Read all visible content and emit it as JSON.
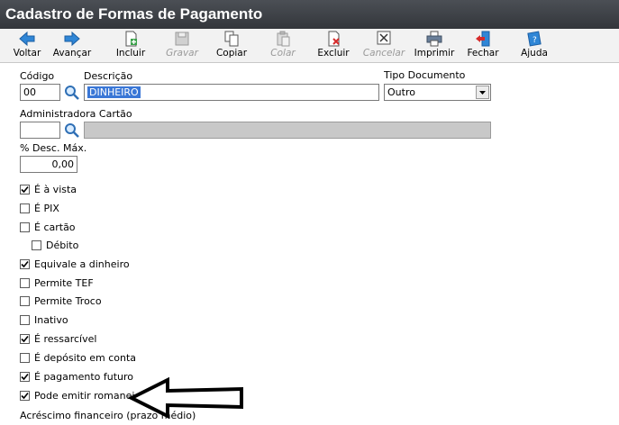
{
  "window": {
    "title": "Cadastro de Formas de Pagamento"
  },
  "toolbar": {
    "voltar": "Voltar",
    "avancar": "Avançar",
    "incluir": "Incluir",
    "gravar": "Gravar",
    "copiar": "Copiar",
    "colar": "Colar",
    "excluir": "Excluir",
    "cancelar": "Cancelar",
    "imprimir": "Imprimir",
    "fechar": "Fechar",
    "ajuda": "Ajuda"
  },
  "form": {
    "codigo_label": "Código",
    "codigo_value": "00",
    "descricao_label": "Descrição",
    "descricao_value": "DINHEIRO",
    "tipo_documento_label": "Tipo Documento",
    "tipo_documento_value": "Outro",
    "administradora_label": "Administradora Cartão",
    "administradora_code": "",
    "administradora_name": "",
    "desc_max_label": "% Desc. Máx.",
    "desc_max_value": "0,00",
    "acrescimo_label": "Acréscimo financeiro (prazo médio)"
  },
  "checkboxes": [
    {
      "label": "É à vista",
      "checked": true
    },
    {
      "label": "É PIX",
      "checked": false
    },
    {
      "label": "É cartão",
      "checked": false
    },
    {
      "label": "Débito",
      "checked": false
    },
    {
      "label": "Equivale a dinheiro",
      "checked": true
    },
    {
      "label": "Permite TEF",
      "checked": false
    },
    {
      "label": "Permite Troco",
      "checked": false
    },
    {
      "label": "Inativo",
      "checked": false
    },
    {
      "label": "É ressarcível",
      "checked": true
    },
    {
      "label": "É depósito em conta",
      "checked": false
    },
    {
      "label": "É pagamento futuro",
      "checked": true
    },
    {
      "label": "Pode emitir romaneio",
      "checked": true
    }
  ]
}
